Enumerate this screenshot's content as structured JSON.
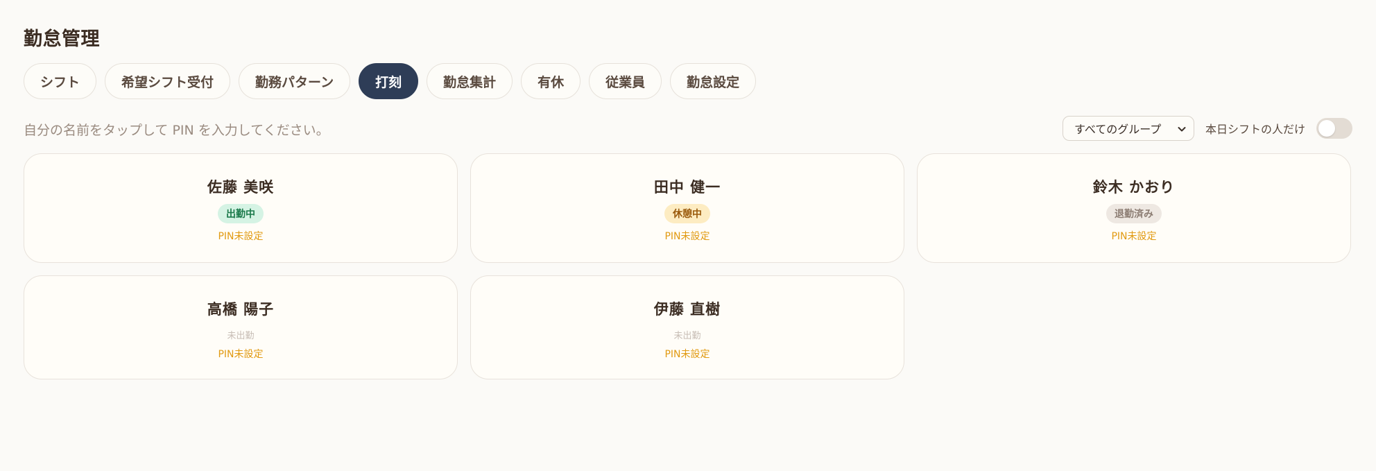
{
  "page": {
    "title": "勤怠管理"
  },
  "tabs": [
    {
      "label": "シフト",
      "active": false
    },
    {
      "label": "希望シフト受付",
      "active": false
    },
    {
      "label": "勤務パターン",
      "active": false
    },
    {
      "label": "打刻",
      "active": true
    },
    {
      "label": "勤怠集計",
      "active": false
    },
    {
      "label": "有休",
      "active": false
    },
    {
      "label": "従業員",
      "active": false
    },
    {
      "label": "勤怠設定",
      "active": false
    }
  ],
  "instructions": "自分の名前をタップして PIN を入力してください。",
  "filters": {
    "group_select": {
      "value": "すべてのグループ",
      "icon": "chevron-down-icon"
    },
    "today_only": {
      "label": "本日シフトの人だけ",
      "on": false
    }
  },
  "employees": [
    {
      "name": "佐藤 美咲",
      "status": "出勤中",
      "pin": "PIN未設定"
    },
    {
      "name": "田中 健一",
      "status": "休憩中",
      "pin": "PIN未設定"
    },
    {
      "name": "鈴木 かおり",
      "status": "退勤済み",
      "pin": "PIN未設定"
    },
    {
      "name": "高橋 陽子",
      "status": "未出勤",
      "pin": "PIN未設定"
    },
    {
      "name": "伊藤 直樹",
      "status": "未出勤",
      "pin": "PIN未設定"
    }
  ],
  "colors": {
    "accent": "#2e3d57",
    "working_bg": "#d5f3e4",
    "working_fg": "#1b7a4b",
    "break_bg": "#fdecc2",
    "break_fg": "#9a5a0c",
    "left_bg": "#eee8e2",
    "left_fg": "#8c7d73",
    "pin_warning": "#e19a12"
  }
}
